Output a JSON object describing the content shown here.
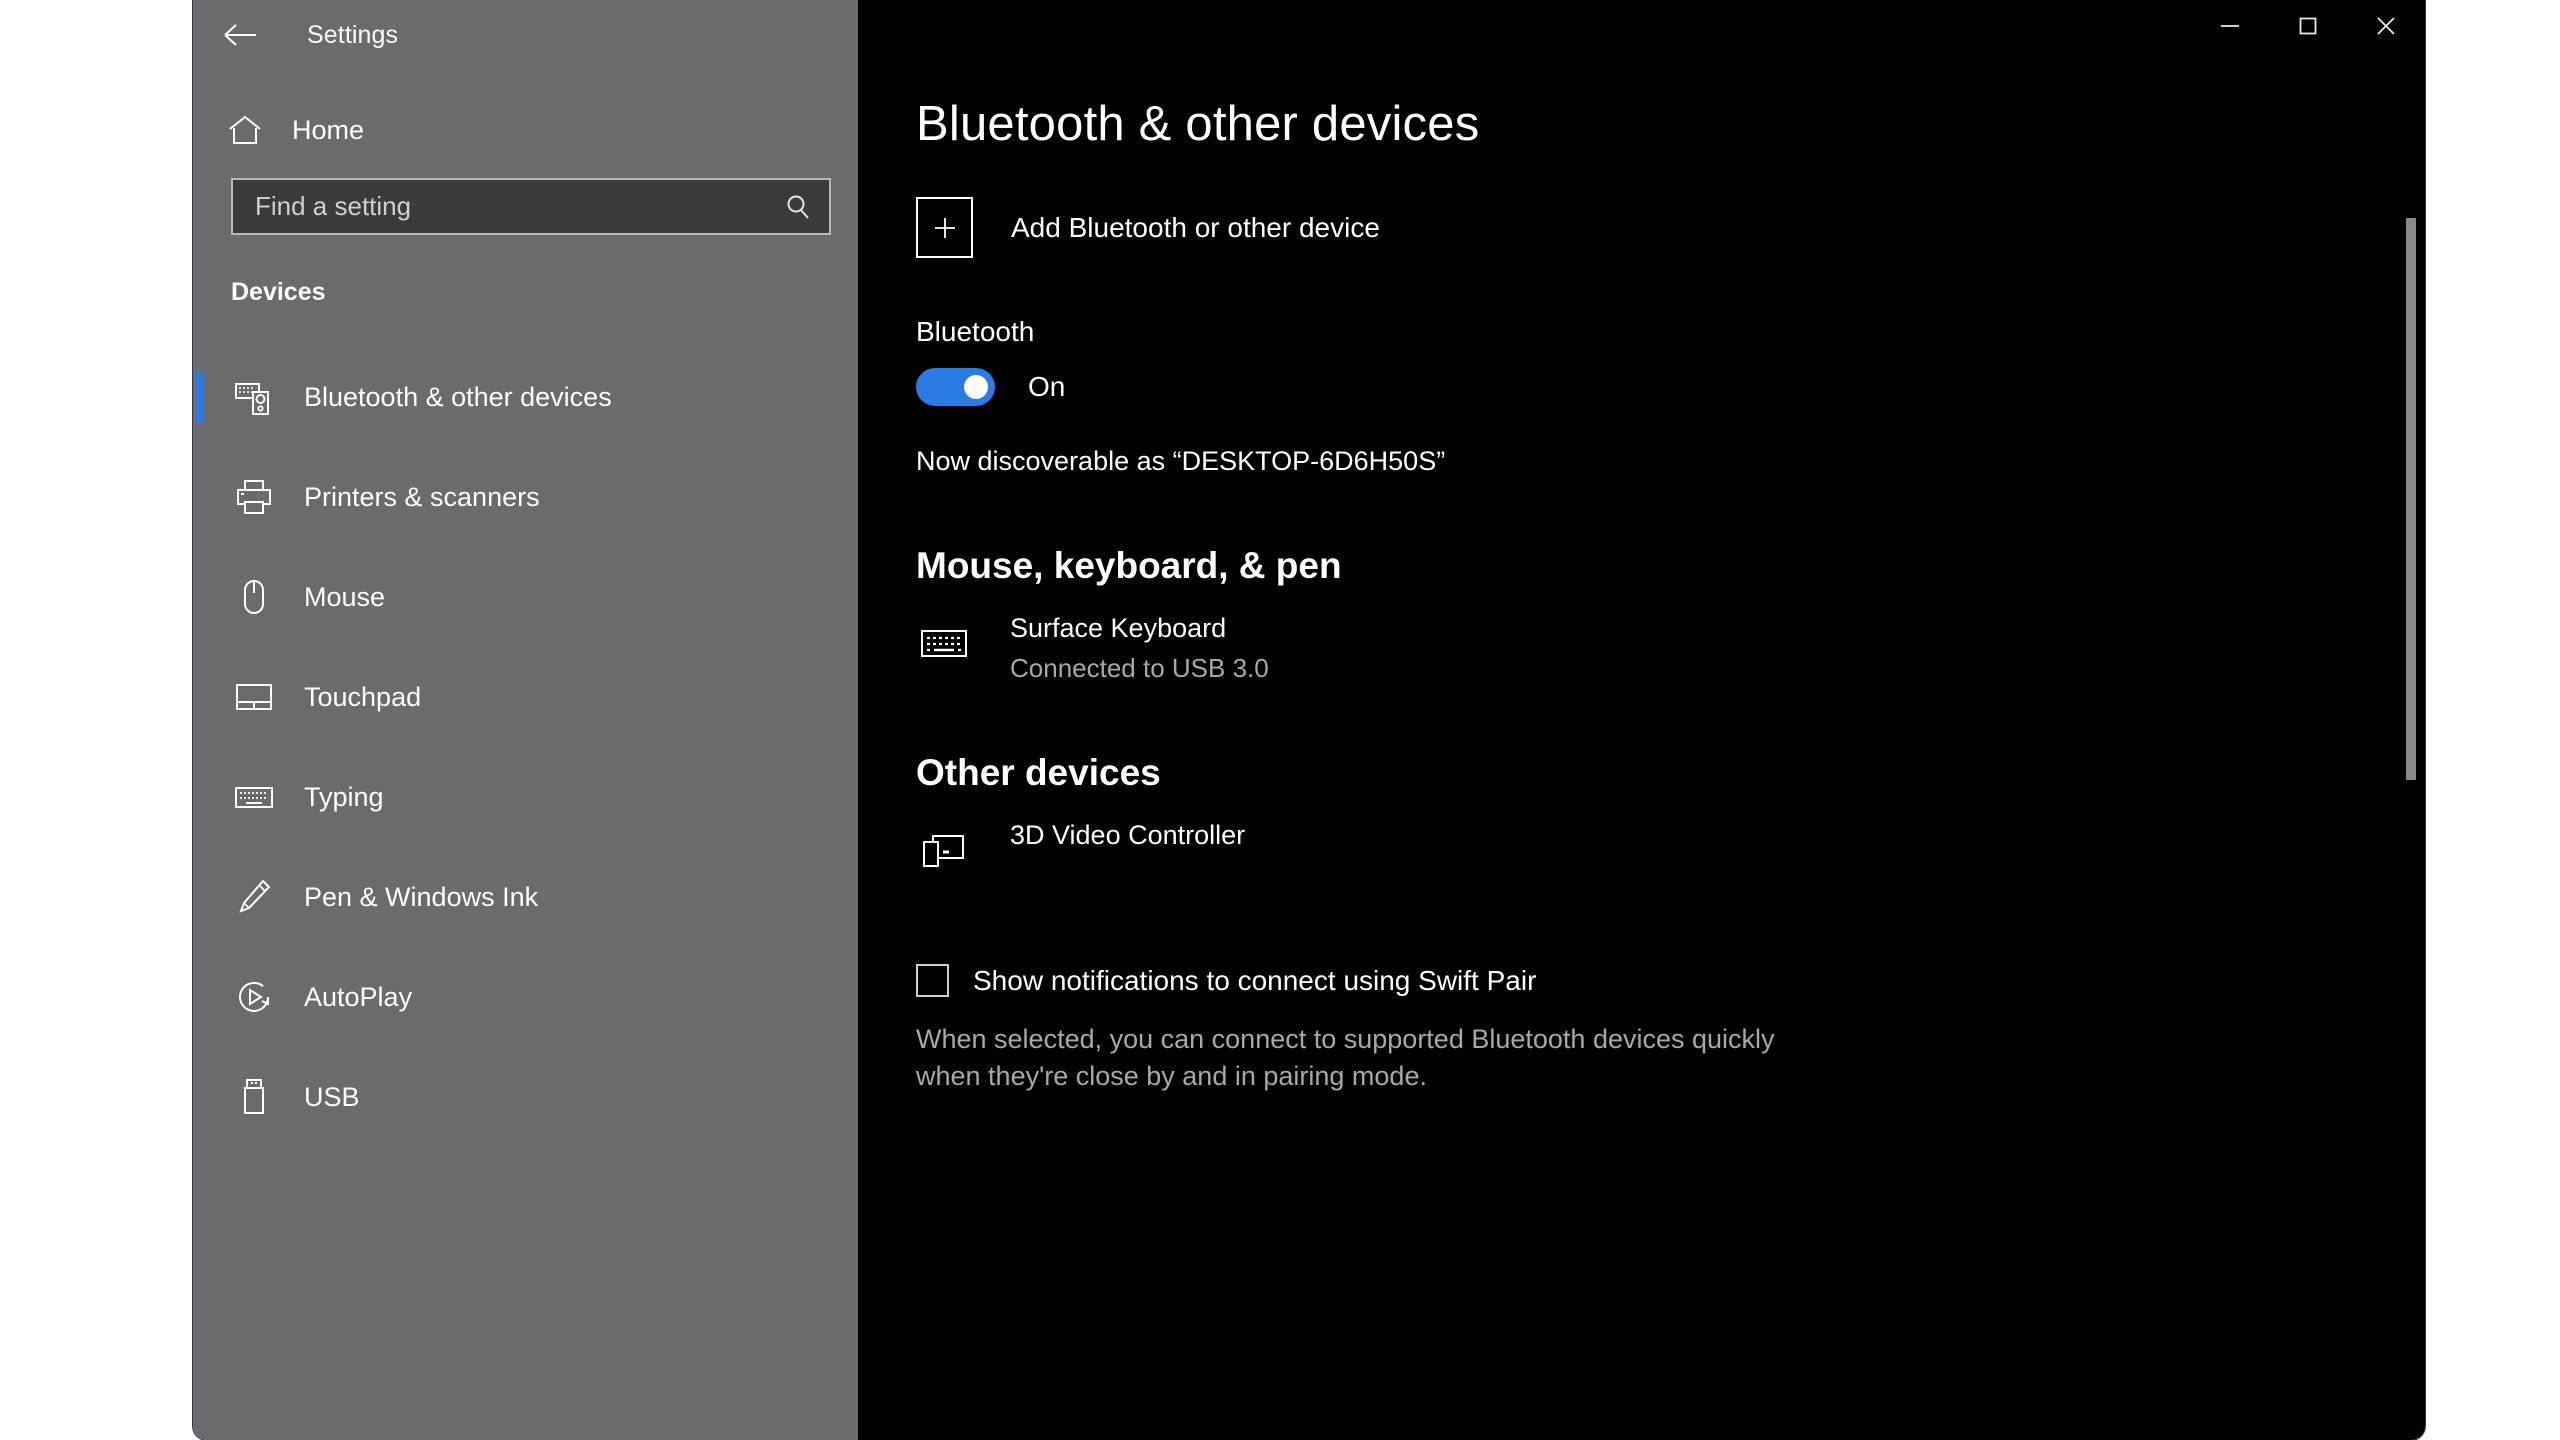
{
  "window": {
    "title": "Settings",
    "back_icon": "back-arrow-icon",
    "controls": {
      "minimize": "minimize-icon",
      "maximize": "maximize-icon",
      "close": "close-icon"
    }
  },
  "sidebar": {
    "home_label": "Home",
    "home_icon": "home-icon",
    "search": {
      "placeholder": "Find a setting",
      "value": "",
      "icon": "search-icon"
    },
    "group_title": "Devices",
    "items": [
      {
        "label": "Bluetooth & other devices",
        "icon": "bluetooth-devices-icon",
        "active": true
      },
      {
        "label": "Printers & scanners",
        "icon": "printer-icon",
        "active": false
      },
      {
        "label": "Mouse",
        "icon": "mouse-icon",
        "active": false
      },
      {
        "label": "Touchpad",
        "icon": "touchpad-icon",
        "active": false
      },
      {
        "label": "Typing",
        "icon": "keyboard-icon",
        "active": false
      },
      {
        "label": "Pen & Windows Ink",
        "icon": "pen-icon",
        "active": false
      },
      {
        "label": "AutoPlay",
        "icon": "autoplay-icon",
        "active": false
      },
      {
        "label": "USB",
        "icon": "usb-icon",
        "active": false
      }
    ]
  },
  "main": {
    "page_title": "Bluetooth & other devices",
    "add_device": {
      "label": "Add Bluetooth or other device",
      "icon": "plus-icon"
    },
    "bluetooth": {
      "label": "Bluetooth",
      "toggle_state": "On",
      "toggle_on": true,
      "discoverable_text": "Now discoverable as “DESKTOP-6D6H50S”"
    },
    "sections": [
      {
        "heading": "Mouse, keyboard, & pen",
        "devices": [
          {
            "name": "Surface Keyboard",
            "status": "Connected to USB 3.0",
            "icon": "keyboard-icon"
          }
        ]
      },
      {
        "heading": "Other devices",
        "devices": [
          {
            "name": "3D Video Controller",
            "status": "",
            "icon": "display-device-icon"
          }
        ]
      }
    ],
    "swift_pair": {
      "label": "Show notifications to connect using Swift Pair",
      "checked": false,
      "description": "When selected, you can connect to supported Bluetooth devices quickly when they're close by and in pairing mode."
    }
  },
  "colors": {
    "accent": "#2a7be4",
    "sidebar_bg": "#6b6b6b",
    "content_bg": "#000000",
    "text_primary": "#ffffff",
    "text_secondary": "#a8a8a8"
  }
}
